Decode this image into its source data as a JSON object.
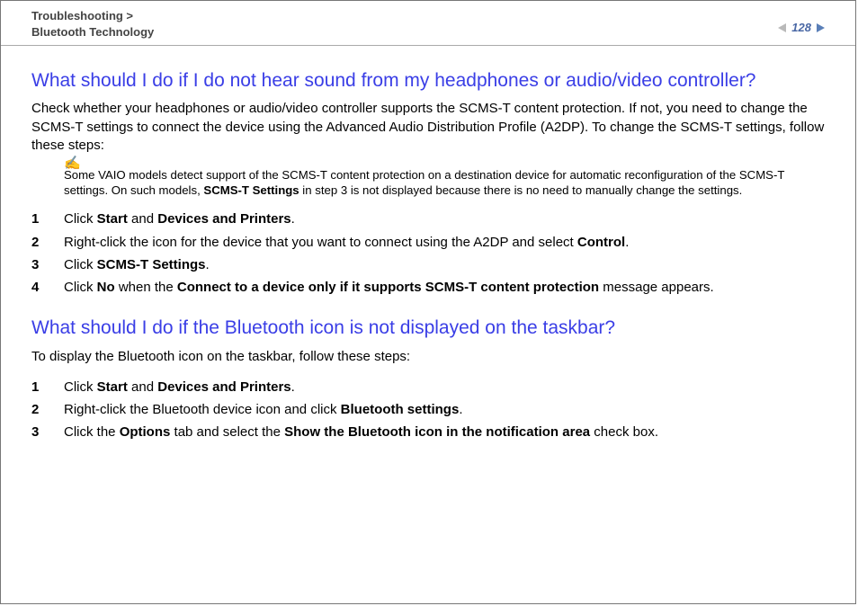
{
  "header": {
    "breadcrumb_line1": "Troubleshooting >",
    "breadcrumb_line2": "Bluetooth Technology",
    "page_number": "128"
  },
  "section1": {
    "heading": "What should I do if I do not hear sound from my headphones or audio/video controller?",
    "intro": "Check whether your headphones or audio/video controller supports the SCMS-T content protection. If not, you need to change the SCMS-T settings to connect the device using the Advanced Audio Distribution Profile (A2DP). To change the SCMS-T settings, follow these steps:",
    "note_icon": "✍",
    "note_pre": "Some VAIO models detect support of the SCMS-T content protection on a destination device for automatic reconfiguration of the SCMS-T settings. On such models, ",
    "note_bold": "SCMS-T Settings",
    "note_post": " in step 3 is not displayed because there is no need to manually change the settings.",
    "steps": {
      "n1": "1",
      "s1a": "Click ",
      "s1b": "Start",
      "s1c": " and ",
      "s1d": "Devices and Printers",
      "s1e": ".",
      "n2": "2",
      "s2a": "Right-click the icon for the device that you want to connect using the A2DP and select ",
      "s2b": "Control",
      "s2c": ".",
      "n3": "3",
      "s3a": "Click ",
      "s3b": "SCMS-T Settings",
      "s3c": ".",
      "n4": "4",
      "s4a": "Click ",
      "s4b": "No",
      "s4c": " when the ",
      "s4d": "Connect to a device only if it supports SCMS-T content protection",
      "s4e": " message appears."
    }
  },
  "section2": {
    "heading": "What should I do if the Bluetooth icon is not displayed on the taskbar?",
    "intro": "To display the Bluetooth icon on the taskbar, follow these steps:",
    "steps": {
      "n1": "1",
      "s1a": "Click ",
      "s1b": "Start",
      "s1c": " and ",
      "s1d": "Devices and Printers",
      "s1e": ".",
      "n2": "2",
      "s2a": "Right-click the Bluetooth device icon and click ",
      "s2b": "Bluetooth settings",
      "s2c": ".",
      "n3": "3",
      "s3a": "Click the ",
      "s3b": "Options",
      "s3c": " tab and select the ",
      "s3d": "Show the Bluetooth icon in the notification area",
      "s3e": " check box."
    }
  }
}
